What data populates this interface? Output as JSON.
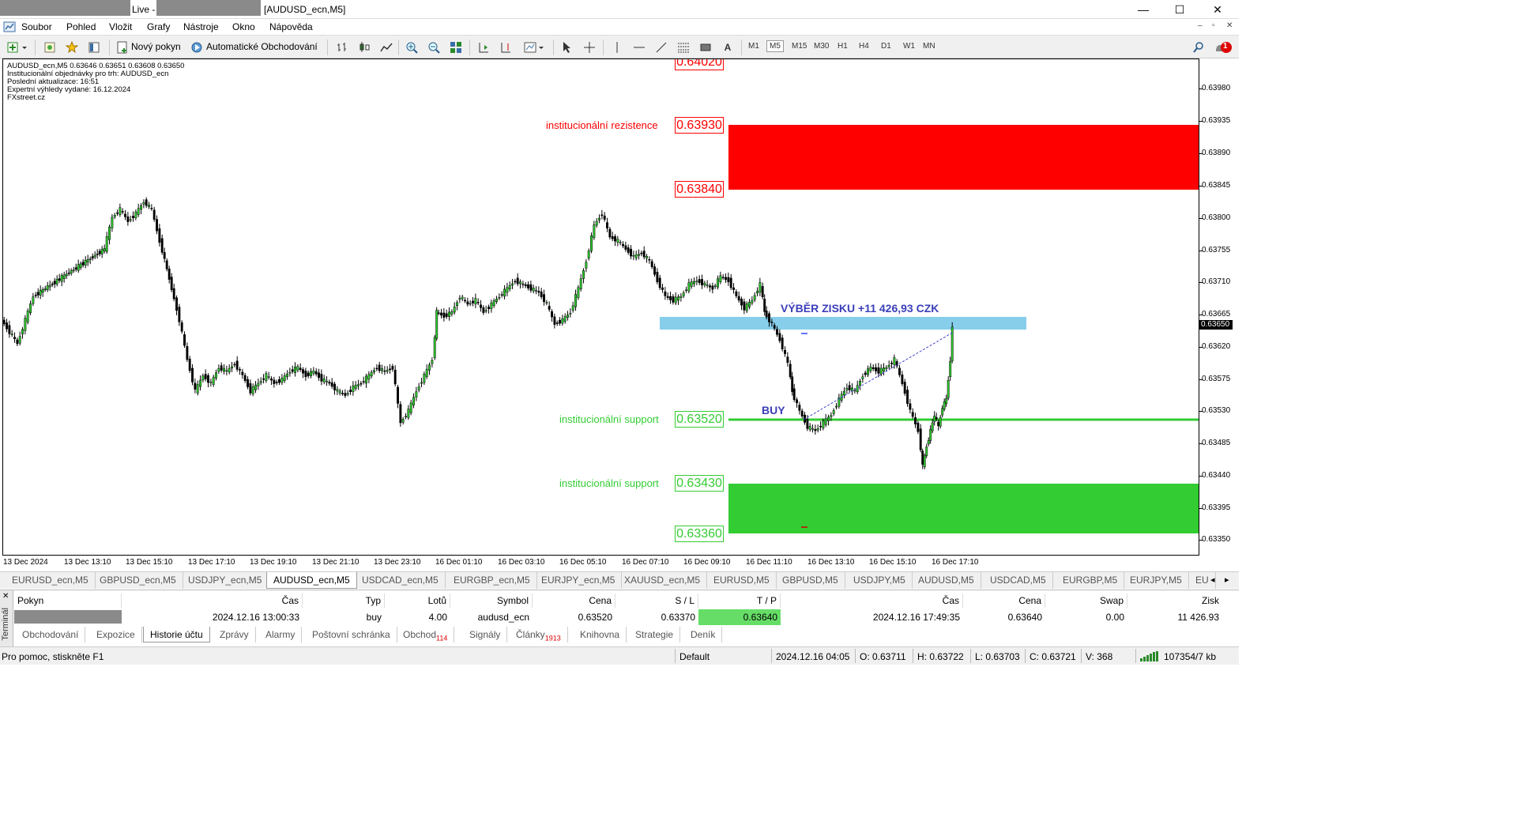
{
  "window": {
    "title_live": "Live -",
    "title_symbol": "[AUDUSD_ecn,M5]",
    "minimize": "—",
    "maximize": "☐",
    "close": "✕"
  },
  "menu": {
    "items": [
      "Soubor",
      "Pohled",
      "Vložit",
      "Grafy",
      "Nástroje",
      "Okno",
      "Nápověda"
    ],
    "mdi_minimize": "–",
    "mdi_restore": "▫",
    "mdi_close": "✕"
  },
  "toolbar": {
    "new_order": "Nový pokyn",
    "auto_trading": "Automatické Obchodování",
    "timeframes": [
      "M1",
      "M5",
      "M15",
      "M30",
      "H1",
      "H4",
      "D1",
      "W1",
      "MN"
    ],
    "active_timeframe": "M5",
    "text_tool": "A",
    "notification_count": "1"
  },
  "chart_info": {
    "line1": "AUDUSD_ecn,M5  0.63646 0.63651 0.63608 0.63650",
    "line2": "Institucionální objednávky pro trh: AUDUSD_ecn",
    "line3": "Poslední aktualizace: 16:51",
    "line4": "Expertní výhledy vydané: 16.12.2024",
    "line5": "FXstreet.cz"
  },
  "levels": {
    "top_cut": "0.64020",
    "resistance_label": "institucionální rezistence",
    "resistance_high": "0.63930",
    "resistance_low": "0.63840",
    "support1_label": "institucionální support",
    "support1": "0.63520",
    "support2_label": "institucionální support",
    "support2_high": "0.63430",
    "support2_low": "0.63360",
    "resistance_color": "#ff0000",
    "support_color": "#33cc33",
    "profit_zone_color": "#87ceeb"
  },
  "annotations": {
    "profit": "VÝBĚR ZISKU +11 426,93 CZK",
    "buy": "BUY"
  },
  "yaxis": {
    "ticks": [
      "0.63980",
      "0.63935",
      "0.63890",
      "0.63845",
      "0.63800",
      "0.63755",
      "0.63710",
      "0.63665",
      "0.63620",
      "0.63575",
      "0.63530",
      "0.63485",
      "0.63440",
      "0.63395",
      "0.63350"
    ],
    "current_price": "0.63650"
  },
  "xaxis": {
    "ticks": [
      "13 Dec 2024",
      "13 Dec 13:10",
      "13 Dec 15:10",
      "13 Dec 17:10",
      "13 Dec 19:10",
      "13 Dec 21:10",
      "13 Dec 23:10",
      "16 Dec 01:10",
      "16 Dec 03:10",
      "16 Dec 05:10",
      "16 Dec 07:10",
      "16 Dec 09:10",
      "16 Dec 11:10",
      "16 Dec 13:10",
      "16 Dec 15:10",
      "16 Dec 17:10"
    ]
  },
  "chart_tabs": [
    "EURUSD_ecn,M5",
    "GBPUSD_ecn,M5",
    "USDJPY_ecn,M5",
    "AUDUSD_ecn,M5",
    "USDCAD_ecn,M5",
    "EURGBP_ecn,M5",
    "EURJPY_ecn,M5",
    "XAUUSD_ecn,M5",
    "EURUSD,M5",
    "GBPUSD,M5",
    "USDJPY,M5",
    "AUDUSD,M5",
    "USDCAD,M5",
    "EURGBP,M5",
    "EURJPY,M5",
    "EU"
  ],
  "active_chart_tab": "AUDUSD_ecn,M5",
  "terminal": {
    "side_label": "Terminál",
    "columns": [
      "Pokyn",
      "Čas",
      "Typ",
      "Lotů",
      "Symbol",
      "Cena",
      "S / L",
      "T / P",
      "Čas",
      "Cena",
      "Swap",
      "Zisk"
    ],
    "row": {
      "open_time": "2024.12.16 13:00:33",
      "type": "buy",
      "lots": "4.00",
      "symbol": "audusd_ecn",
      "price": "0.63520",
      "sl": "0.63370",
      "tp": "0.63640",
      "close_time": "2024.12.16 17:49:35",
      "close_price": "0.63640",
      "swap": "0.00",
      "profit": "11 426.93"
    },
    "tabs": [
      "Obchodování",
      "Expozice",
      "Historie účtu",
      "Zprávy",
      "Alarmy",
      "Poštovní schránka",
      "Obchod",
      "Signály",
      "Články",
      "Knihovna",
      "Strategie",
      "Deník"
    ],
    "active_tab": "Historie účtu",
    "obchod_badge": "114",
    "clanky_badge": "1913"
  },
  "status": {
    "help": "Pro pomoc, stiskněte F1",
    "profile": "Default",
    "datetime": "2024.12.16 04:05",
    "open": "O: 0.63711",
    "high": "H: 0.63722",
    "low": "L: 0.63703",
    "close": "C: 0.63721",
    "volume": "V: 368",
    "traffic": "107354/7 kb"
  }
}
